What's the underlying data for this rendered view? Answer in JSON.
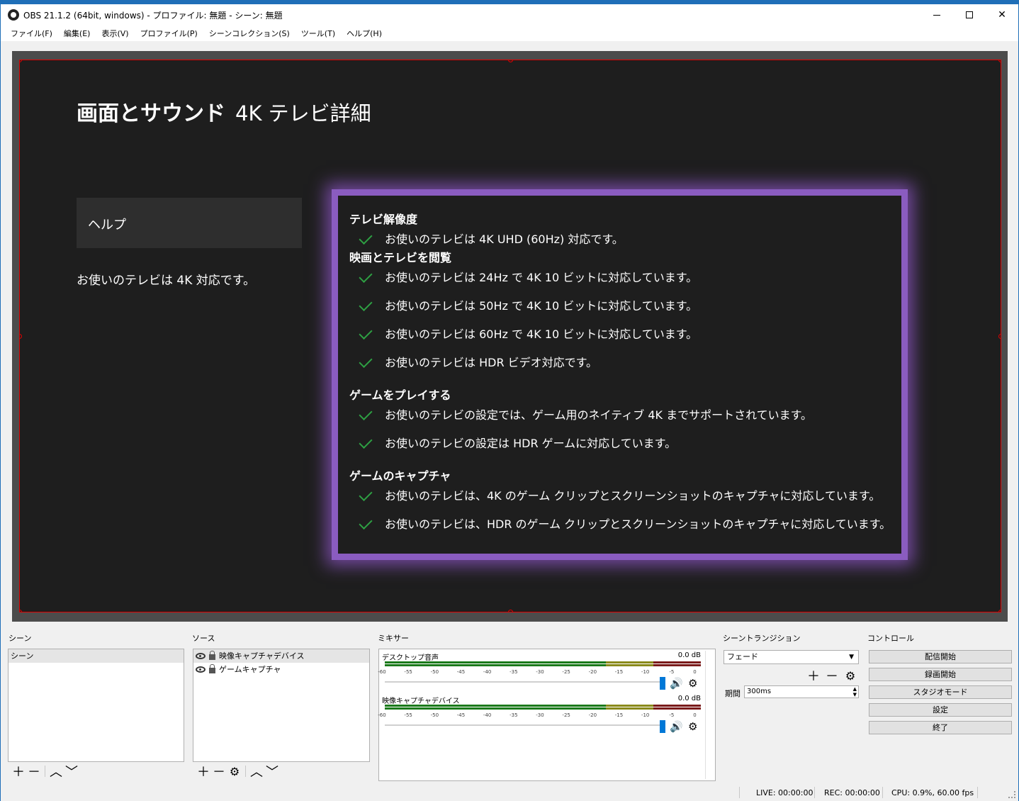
{
  "window": {
    "title": "OBS 21.1.2 (64bit, windows) - プロファイル: 無題 - シーン: 無題",
    "close_glyph": "✕"
  },
  "menu": [
    "ファイル(F)",
    "編集(E)",
    "表示(V)",
    "プロファイル(P)",
    "シーンコレクション(S)",
    "ツール(T)",
    "ヘルプ(H)"
  ],
  "preview": {
    "title_bold": "画面とサウンド",
    "title_light": "4K テレビ詳細",
    "help_label": "ヘルプ",
    "help_text": "お使いのテレビは 4K 対応です。",
    "sections": [
      {
        "heading": "テレビ解像度",
        "items": [
          "お使いのテレビは 4K UHD (60Hz) 対応です。"
        ]
      },
      {
        "heading": "映画とテレビを閲覧",
        "items": [
          "お使いのテレビは 24Hz で 4K 10 ビットに対応しています。",
          "お使いのテレビは 50Hz で 4K 10 ビットに対応しています。",
          "お使いのテレビは 60Hz で 4K 10 ビットに対応しています。",
          "お使いのテレビは HDR ビデオ対応です。"
        ]
      },
      {
        "heading": "ゲームをプレイする",
        "items": [
          "お使いのテレビの設定では、ゲーム用のネイティブ 4K までサポートされています。",
          "お使いのテレビの設定は HDR ゲームに対応しています。"
        ]
      },
      {
        "heading": "ゲームのキャプチャ",
        "items": [
          "お使いのテレビは、4K のゲーム クリップとスクリーンショットのキャプチャに対応しています。",
          "お使いのテレビは、HDR のゲーム クリップとスクリーンショットのキャプチャに対応しています。"
        ]
      }
    ]
  },
  "docks": {
    "scenes": {
      "title": "シーン",
      "items": [
        "シーン"
      ]
    },
    "sources": {
      "title": "ソース",
      "items": [
        "映像キャプチャデバイス",
        "ゲームキャプチャ"
      ]
    },
    "mixer": {
      "title": "ミキサー",
      "tracks": [
        {
          "name": "デスクトップ音声",
          "db": "0.0 dB"
        },
        {
          "name": "映像キャプチャデバイス",
          "db": "0.0 dB"
        }
      ],
      "ticks": [
        "-60",
        "-55",
        "-50",
        "-45",
        "-40",
        "-35",
        "-30",
        "-25",
        "-20",
        "-15",
        "-10",
        "-5",
        "0"
      ]
    },
    "transitions": {
      "title": "シーントランジション",
      "selected": "フェード",
      "duration_label": "期間",
      "duration_value": "300ms"
    },
    "controls": {
      "title": "コントロール",
      "buttons": [
        "配信開始",
        "録画開始",
        "スタジオモード",
        "設定",
        "終了"
      ]
    }
  },
  "status": {
    "live": "LIVE: 00:00:00",
    "rec": "REC: 00:00:00",
    "cpu": "CPU: 0.9%, 60.00 fps"
  },
  "colors": {
    "accent_purple": "#8a5cc0",
    "check_green": "#2ea043",
    "selection_red": "#e00000",
    "slider_blue": "#0078d7"
  }
}
